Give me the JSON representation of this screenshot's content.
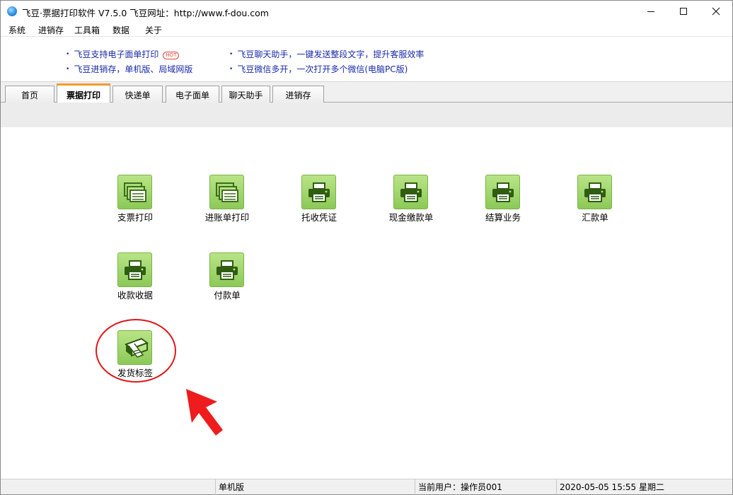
{
  "window": {
    "title": "飞豆·票据打印软件 V7.5.0  飞豆网址：http://www.f-dou.com"
  },
  "menu": [
    "系统",
    "进销存",
    "工具箱",
    "数据",
    "关于"
  ],
  "ads": [
    {
      "text": "飞豆支持电子面单打印",
      "badge": "HOT"
    },
    {
      "text": "飞豆聊天助手，一键发送整段文字，提升客服效率"
    },
    {
      "text": "飞豆进销存，单机版、局域网版"
    },
    {
      "text": "飞豆微信多开，一次打开多个微信(电脑PC版)"
    }
  ],
  "tabs": [
    {
      "label": "首页",
      "active": false
    },
    {
      "label": "票据打印",
      "active": true
    },
    {
      "label": "快递单",
      "active": false
    },
    {
      "label": "电子面单",
      "active": false
    },
    {
      "label": "聊天助手",
      "active": false
    },
    {
      "label": "进销存",
      "active": false
    }
  ],
  "tiles": [
    {
      "label": "支票打印",
      "icon": "documents-icon"
    },
    {
      "label": "进账单打印",
      "icon": "documents-icon"
    },
    {
      "label": "托收凭证",
      "icon": "printer-icon"
    },
    {
      "label": "现金缴款单",
      "icon": "printer-icon"
    },
    {
      "label": "结算业务",
      "icon": "printer-icon"
    },
    {
      "label": "汇款单",
      "icon": "printer-icon"
    },
    {
      "label": "收款收据",
      "icon": "printer-icon"
    },
    {
      "label": "付款单",
      "icon": "printer-icon"
    },
    {
      "label": "发货标签",
      "icon": "label-printer-icon"
    }
  ],
  "status": {
    "edition": "单机版",
    "user": "当前用户：操作员001",
    "datetime": "2020-05-05 15:55 星期二"
  },
  "colors": {
    "tab_accent": "#f29a2a",
    "tile_green": "#8cc958",
    "link_blue": "#1a2aa8",
    "highlight_red": "#e01616"
  }
}
